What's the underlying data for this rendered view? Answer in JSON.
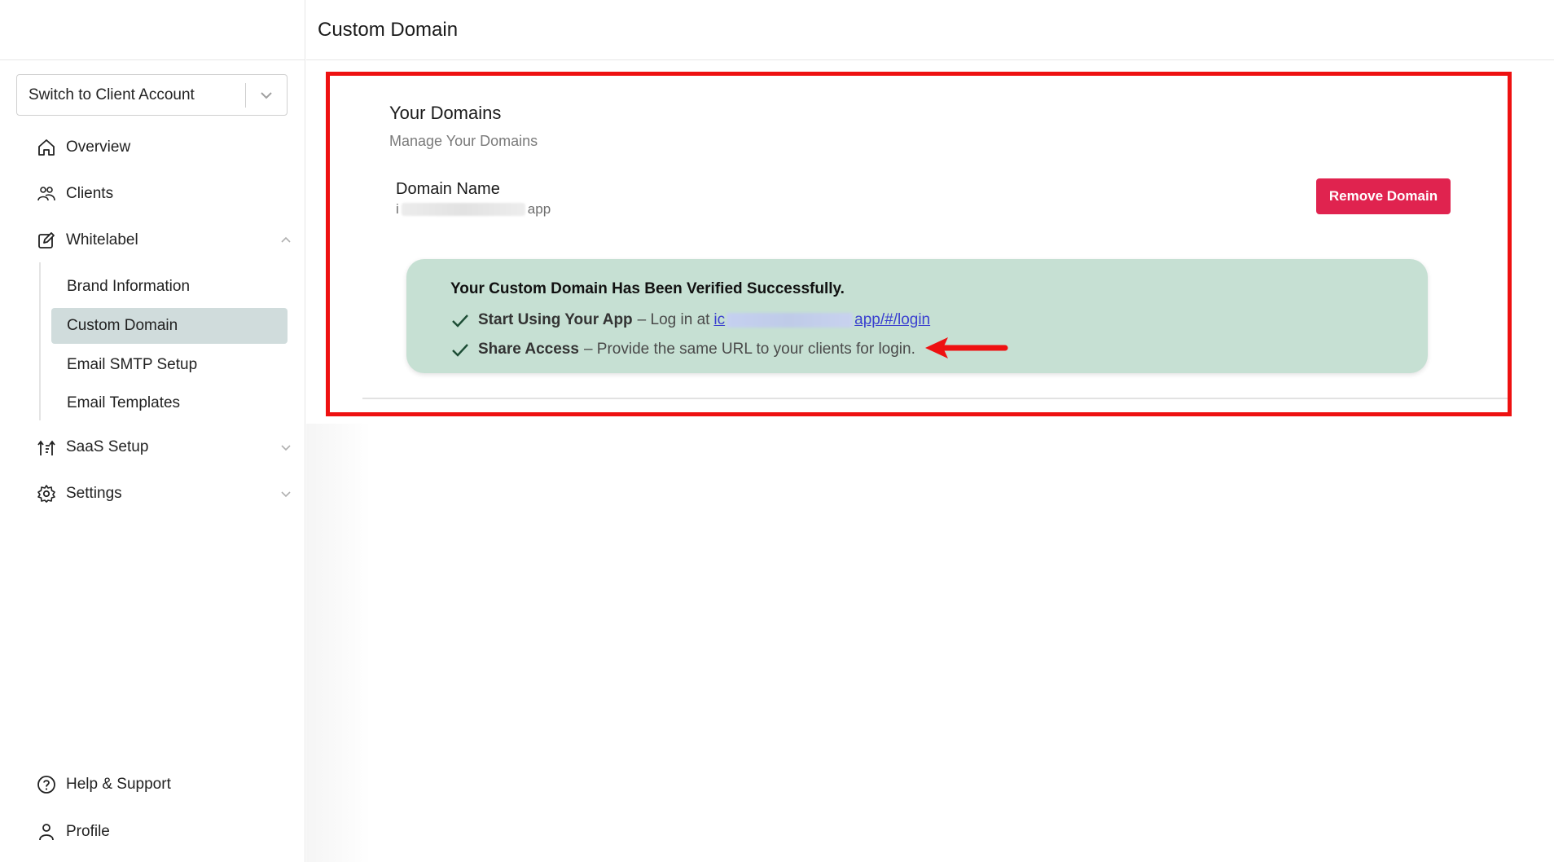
{
  "header": {
    "title": "Custom Domain"
  },
  "sidebar": {
    "account_switch": {
      "label": "Switch to Client Account"
    },
    "items": [
      {
        "label": "Overview",
        "icon": "home-icon"
      },
      {
        "label": "Clients",
        "icon": "users-icon"
      },
      {
        "label": "Whitelabel",
        "icon": "edit-icon"
      },
      {
        "label": "SaaS Setup",
        "icon": "saas-icon"
      },
      {
        "label": "Settings",
        "icon": "gear-icon"
      }
    ],
    "whitelabel_sub": [
      {
        "label": "Brand Information"
      },
      {
        "label": "Custom Domain",
        "active": true
      },
      {
        "label": "Email SMTP Setup"
      },
      {
        "label": "Email Templates"
      }
    ],
    "bottom": [
      {
        "label": "Help & Support",
        "icon": "help-icon"
      },
      {
        "label": "Profile",
        "icon": "user-icon"
      }
    ]
  },
  "domains": {
    "title": "Your Domains",
    "subtitle": "Manage Your Domains",
    "domain_label": "Domain Name",
    "domain_prefix": "i",
    "domain_suffix": "app",
    "remove_label": "Remove Domain"
  },
  "success": {
    "title": "Your Custom Domain Has Been Verified Successfully.",
    "line1_bold": "Start Using Your App",
    "line1_text": "– Log in at",
    "line1_link_prefix": "ic",
    "line1_link_suffix": "app/#/login",
    "line2_bold": "Share Access",
    "line2_text": "– Provide the same URL to your clients for login."
  },
  "colors": {
    "highlight": "#ee1111",
    "remove_button": "#e0234f",
    "success_bg": "#c6e0d3",
    "active_nav": "#d0dcdc",
    "link": "#3a3fd0"
  }
}
